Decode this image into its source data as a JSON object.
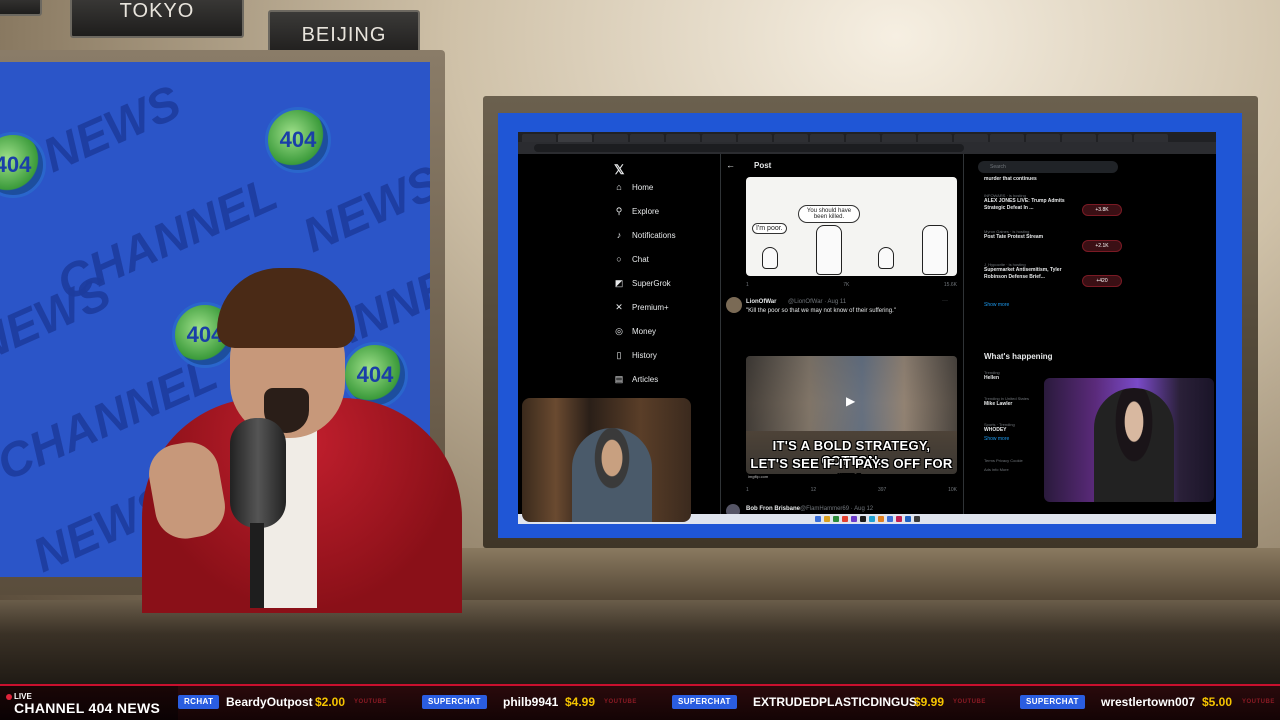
{
  "studio": {
    "city_signs": [
      "TOKYO",
      "BEIJING"
    ],
    "screen_bg_text": [
      "NEWS",
      "CHANNEL",
      "NEWS",
      "CHANNEL",
      "NEWS",
      "CHANNEL",
      "NEWS"
    ],
    "logo_text": "404"
  },
  "x_app": {
    "nav": [
      {
        "label": "Home",
        "icon": "home-icon"
      },
      {
        "label": "Explore",
        "icon": "search-icon"
      },
      {
        "label": "Notifications",
        "icon": "bell-icon"
      },
      {
        "label": "Chat",
        "icon": "chat-icon"
      },
      {
        "label": "SuperGrok",
        "icon": "grok-icon"
      },
      {
        "label": "Premium+",
        "icon": "x-premium-icon"
      },
      {
        "label": "Money",
        "icon": "money-icon"
      },
      {
        "label": "History",
        "icon": "bookmark-icon"
      },
      {
        "label": "Articles",
        "icon": "article-icon"
      }
    ],
    "post_title": "Post",
    "meme1": {
      "bubble_right": "You should have been killed.",
      "bubble_left": "I'm poor."
    },
    "meme1_actions": [
      "1",
      "7K",
      "15.6K"
    ],
    "tweet2": {
      "name": "LionOfWar",
      "meta": "@LionOfWar · Aug 11",
      "text": "\"Kill the poor so that we may not know of their suffering.\""
    },
    "meme2": {
      "caption_line1": "IT'S A BOLD STRATEGY, COTTON.",
      "caption_line2": "LET'S SEE IF IT PAYS OFF FOR 'EM.",
      "source": "imgflip.com"
    },
    "meme2_actions": [
      "1",
      "12",
      "397",
      "10K"
    ],
    "tweet3": {
      "name": "Bob Fron Brisbane",
      "meta": "@FlamHammer69 · Aug 12"
    },
    "search_placeholder": "Search",
    "trends_top": [
      {
        "category": "INFOWARS · is hosting",
        "title": "ALEX JONES LIVE: Trump Admits Strategic Defeat In ...",
        "count": "+3.8K"
      },
      {
        "category": "Myron Gaines · is hosting",
        "title": "Post Tate Protest Stream",
        "count": "+2.1K"
      },
      {
        "category": "J_Hypocrite · is hosting",
        "title": "Supermarket Antisemitism, Tyler Robinson Defense Brief...",
        "count": "+420"
      }
    ],
    "trend_header_partial": "murder that continues",
    "show_more": "Show more",
    "whats_happening": "What's happening",
    "happening": [
      {
        "category": "Trending",
        "title": "Hellen"
      },
      {
        "category": "Trending in United States",
        "title": "Mike Lawler"
      },
      {
        "category": "Sports · Trending",
        "title": "WHODEY"
      }
    ],
    "show_more_2": "Show more",
    "footer_links": "Terms  Privacy  Cookie",
    "footer_links_2": "Ads info  More"
  },
  "ticker": {
    "live": "LIVE",
    "channel": "CHANNEL 404 NEWS",
    "items": [
      {
        "tag": "RCHAT",
        "user": "BeardyOutpost",
        "amount": "$2.00",
        "src": "YOUTUBE"
      },
      {
        "tag": "SUPERCHAT",
        "user": "philb9941",
        "amount": "$4.99",
        "src": "YOUTUBE"
      },
      {
        "tag": "SUPERCHAT",
        "user": "EXTRUDEDPLASTICDINGUS",
        "amount": "$9.99",
        "src": "YOUTUBE"
      },
      {
        "tag": "SUPERCHAT",
        "user": "wrestlertown007",
        "amount": "$5.00",
        "src": "YOUTUBE"
      }
    ]
  },
  "colors": {
    "brand_blue": "#2b55c8",
    "ticker_red": "#c8102e",
    "x_blue": "#1d9bf0",
    "superchat_yellow": "#f5c400"
  }
}
